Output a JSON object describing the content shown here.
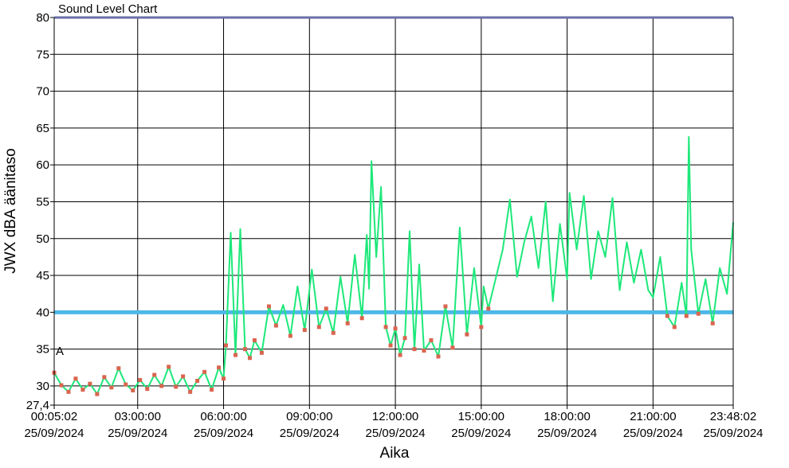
{
  "chart_data": {
    "type": "line",
    "title": "Sound Level Chart",
    "xlabel": "Aika",
    "ylabel": "JWX dBA äänitaso",
    "ylim": [
      27.4,
      80
    ],
    "y_ticks": [
      "80",
      "75",
      "70",
      "65",
      "60",
      "55",
      "50",
      "45",
      "40",
      "35",
      "30",
      "27,4"
    ],
    "x_range": [
      "2024-09-25 00:05:02",
      "2024-09-25 23:48:02"
    ],
    "x_tick_labels": [
      {
        "time": "00:05:02",
        "date": "25/09/2024"
      },
      {
        "time": "03:00:00",
        "date": "25/09/2024"
      },
      {
        "time": "06:00:00",
        "date": "25/09/2024"
      },
      {
        "time": "09:00:00",
        "date": "25/09/2024"
      },
      {
        "time": "12:00:00",
        "date": "25/09/2024"
      },
      {
        "time": "15:00:00",
        "date": "25/09/2024"
      },
      {
        "time": "18:00:00",
        "date": "25/09/2024"
      },
      {
        "time": "21:00:00",
        "date": "25/09/2024"
      },
      {
        "time": "23:48:02",
        "date": "25/09/2024"
      }
    ],
    "marker_text": "A",
    "grid": true,
    "reference_lines": [
      {
        "value": 40,
        "color": "#4db8e8"
      },
      {
        "value": 80,
        "color": "#6a6fa8"
      }
    ],
    "series": [
      {
        "color": "#1de87a",
        "marker_color": "#d9654f",
        "points": [
          [
            "00:05",
            31.8
          ],
          [
            "00:20",
            30.1
          ],
          [
            "00:35",
            29.2
          ],
          [
            "00:50",
            31.0
          ],
          [
            "01:05",
            29.5
          ],
          [
            "01:20",
            30.3
          ],
          [
            "01:35",
            28.9
          ],
          [
            "01:50",
            31.2
          ],
          [
            "02:05",
            29.8
          ],
          [
            "02:20",
            32.4
          ],
          [
            "02:35",
            30.2
          ],
          [
            "02:50",
            29.4
          ],
          [
            "03:05",
            30.8
          ],
          [
            "03:20",
            29.6
          ],
          [
            "03:35",
            31.5
          ],
          [
            "03:50",
            30.0
          ],
          [
            "04:05",
            32.6
          ],
          [
            "04:20",
            29.9
          ],
          [
            "04:35",
            31.3
          ],
          [
            "04:50",
            29.2
          ],
          [
            "05:05",
            30.7
          ],
          [
            "05:20",
            31.9
          ],
          [
            "05:35",
            29.5
          ],
          [
            "05:50",
            32.5
          ],
          [
            "06:00",
            31.0
          ],
          [
            "06:05",
            35.5
          ],
          [
            "06:15",
            50.8
          ],
          [
            "06:25",
            34.2
          ],
          [
            "06:35",
            51.3
          ],
          [
            "06:45",
            35.0
          ],
          [
            "06:55",
            33.8
          ],
          [
            "07:05",
            36.2
          ],
          [
            "07:20",
            34.5
          ],
          [
            "07:35",
            40.8
          ],
          [
            "07:50",
            38.2
          ],
          [
            "08:05",
            41.0
          ],
          [
            "08:20",
            36.8
          ],
          [
            "08:35",
            43.5
          ],
          [
            "08:50",
            37.6
          ],
          [
            "09:05",
            45.8
          ],
          [
            "09:20",
            38.0
          ],
          [
            "09:35",
            40.5
          ],
          [
            "09:50",
            37.2
          ],
          [
            "10:05",
            44.8
          ],
          [
            "10:20",
            38.5
          ],
          [
            "10:35",
            47.8
          ],
          [
            "10:50",
            39.2
          ],
          [
            "11:00",
            50.5
          ],
          [
            "11:05",
            43.2
          ],
          [
            "11:10",
            60.5
          ],
          [
            "11:20",
            47.5
          ],
          [
            "11:30",
            57.0
          ],
          [
            "11:40",
            38.0
          ],
          [
            "11:50",
            35.5
          ],
          [
            "12:00",
            37.8
          ],
          [
            "12:10",
            34.2
          ],
          [
            "12:20",
            36.5
          ],
          [
            "12:30",
            51.0
          ],
          [
            "12:40",
            35.0
          ],
          [
            "12:50",
            46.5
          ],
          [
            "13:00",
            34.8
          ],
          [
            "13:15",
            36.2
          ],
          [
            "13:30",
            34.0
          ],
          [
            "13:45",
            40.8
          ],
          [
            "14:00",
            35.2
          ],
          [
            "14:15",
            51.5
          ],
          [
            "14:30",
            37.0
          ],
          [
            "14:45",
            46.0
          ],
          [
            "15:00",
            38.0
          ],
          [
            "15:05",
            43.5
          ],
          [
            "15:15",
            40.5
          ],
          [
            "15:30",
            44.5
          ],
          [
            "15:45",
            48.5
          ],
          [
            "16:00",
            55.3
          ],
          [
            "16:15",
            44.8
          ],
          [
            "16:30",
            49.5
          ],
          [
            "16:45",
            53.0
          ],
          [
            "17:00",
            46.0
          ],
          [
            "17:15",
            55.0
          ],
          [
            "17:30",
            41.5
          ],
          [
            "17:45",
            52.0
          ],
          [
            "18:00",
            44.5
          ],
          [
            "18:05",
            56.2
          ],
          [
            "18:20",
            48.5
          ],
          [
            "18:35",
            55.8
          ],
          [
            "18:50",
            44.5
          ],
          [
            "19:05",
            51.0
          ],
          [
            "19:20",
            47.5
          ],
          [
            "19:35",
            55.5
          ],
          [
            "19:50",
            43.0
          ],
          [
            "20:05",
            49.5
          ],
          [
            "20:20",
            44.0
          ],
          [
            "20:35",
            48.5
          ],
          [
            "20:50",
            43.0
          ],
          [
            "21:00",
            42.0
          ],
          [
            "21:15",
            47.5
          ],
          [
            "21:30",
            39.5
          ],
          [
            "21:45",
            38.0
          ],
          [
            "22:00",
            44.0
          ],
          [
            "22:10",
            39.5
          ],
          [
            "22:15",
            63.8
          ],
          [
            "22:20",
            48.5
          ],
          [
            "22:35",
            39.8
          ],
          [
            "22:50",
            44.5
          ],
          [
            "23:05",
            38.5
          ],
          [
            "23:20",
            46.0
          ],
          [
            "23:35",
            42.5
          ],
          [
            "23:48",
            52.2
          ]
        ]
      }
    ]
  }
}
